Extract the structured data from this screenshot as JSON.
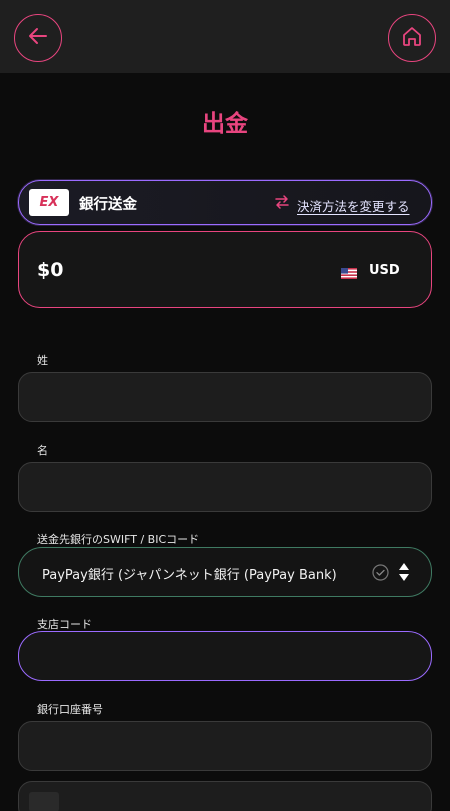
{
  "header": {
    "back_icon": "arrow-left-icon",
    "home_icon": "home-icon",
    "accent": "#e8457f"
  },
  "page": {
    "title": "出金"
  },
  "payment_method": {
    "logo_text": "EX",
    "name": "銀行送金",
    "swap_icon": "swap-arrows-icon",
    "change_label": "決済方法を変更する"
  },
  "amount": {
    "value": "$0",
    "currency": "USD",
    "flag_icon": "us-flag-icon"
  },
  "form": {
    "last_name": {
      "label": "姓",
      "value": ""
    },
    "first_name": {
      "label": "名",
      "value": ""
    },
    "swift": {
      "label": "送金先銀行のSWIFT / BICコード",
      "value": "PayPay銀行 (ジャパンネット銀行 (PayPay Bank)"
    },
    "branch_code": {
      "label": "支店コード",
      "value": ""
    },
    "account_number": {
      "label": "銀行口座番号",
      "value": ""
    }
  }
}
